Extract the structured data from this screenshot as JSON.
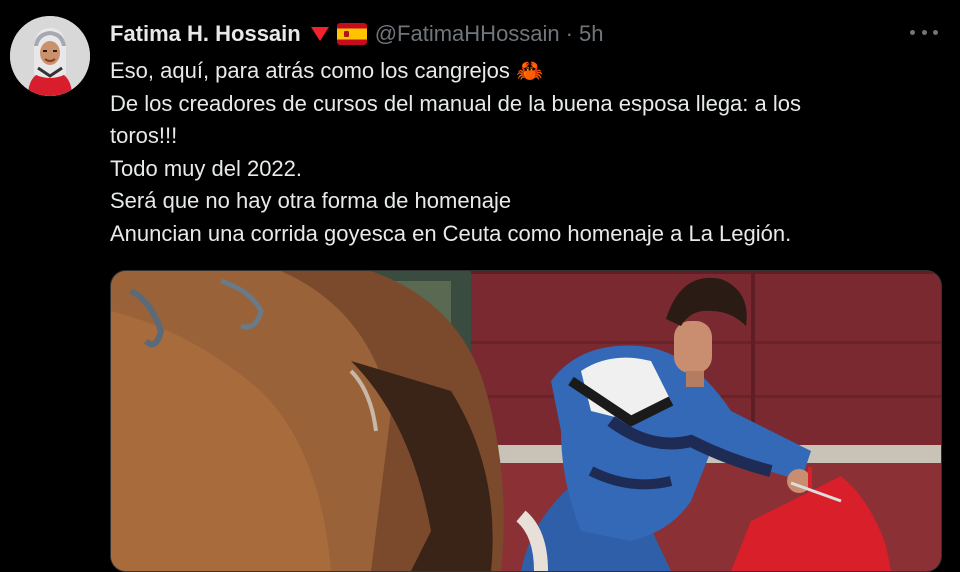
{
  "tweet": {
    "author": {
      "name": "Fatima H. Hossain",
      "handle": "@FatimaHHossain",
      "badge_icon": "red-triangle-icon",
      "flag_icon": "spain-flag-icon"
    },
    "separator": "·",
    "time": "5h",
    "more_icon": "more-options-icon",
    "lines": [
      "Eso, aquí, para atrás como los cangrejos",
      "De los creadores de cursos del manual de la buena esposa llega: a los",
      "toros!!!",
      "Todo muy del 2022.",
      "Será que no hay otra forma de homenaje",
      "Anuncian una corrida goyesca en Ceuta como homenaje a La Legión."
    ],
    "emoji": "🦀",
    "media": "bullfight-photo"
  },
  "colors": {
    "background": "#000000",
    "text": "#e7e9ea",
    "secondary": "#71767b",
    "badge": "#f4212e"
  }
}
